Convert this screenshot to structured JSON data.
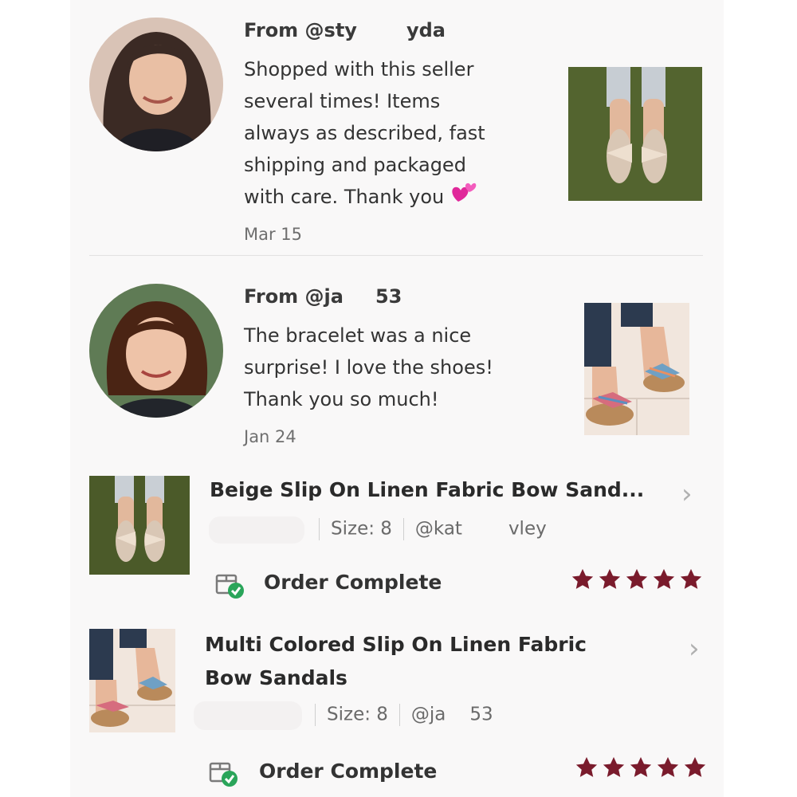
{
  "reviews": [
    {
      "from_prefix": "From @sty",
      "from_suffix": "yda",
      "text_lines": [
        "Shopped with this seller",
        "several times! Items",
        "always as described, fast",
        "shipping and packaged",
        "with care. Thank you"
      ],
      "emoji_icon": "two-hearts-icon",
      "date": "Mar 15"
    },
    {
      "from_prefix": "From @ja",
      "from_suffix": "53",
      "text_lines": [
        "The bracelet was a nice",
        "surprise! I love the shoes!",
        "Thank you so much!"
      ],
      "date": "Jan 24"
    }
  ],
  "orders": [
    {
      "title_lines": [
        "Beige Slip On Linen Fabric Bow Sand..."
      ],
      "size": "Size: 8",
      "seller_prefix": "@kat",
      "seller_suffix": "vley",
      "status": "Order Complete",
      "rating": 5
    },
    {
      "title_lines": [
        "Multi Colored Slip On Linen Fabric",
        "Bow Sandals"
      ],
      "size": "Size: 8",
      "seller_prefix": "@ja",
      "seller_suffix": "53",
      "status": "Order Complete",
      "rating": 5
    }
  ],
  "colors": {
    "star": "#7a1b2c",
    "check": "#2aa55a",
    "panel": "#f9f8f8"
  }
}
